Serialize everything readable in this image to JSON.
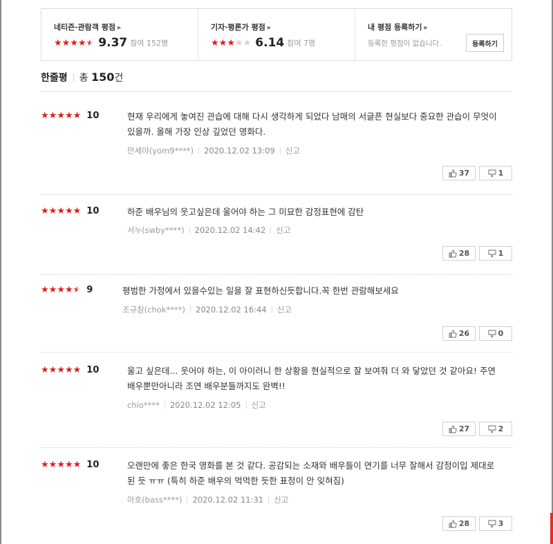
{
  "summary": {
    "netizen": {
      "title": "네티즌·관람객 평점",
      "stars": 4.7,
      "score": "9.37",
      "participants": "참여 152명"
    },
    "critic": {
      "title": "기자·평론가 평점",
      "stars": 3,
      "score": "6.14",
      "participants": "참여 7명"
    },
    "mine": {
      "title": "내 평점 등록하기",
      "empty_text": "등록한 평점이 없습니다.",
      "button_label": "등록하기"
    }
  },
  "reviews_header": {
    "label": "한줄평",
    "prefix": "총 ",
    "count": "150",
    "suffix": "건"
  },
  "reviews": [
    {
      "stars": 5,
      "score": "10",
      "text": "현재 우리에게 놓여진 관습에 대해 다시 생각하게 되었다 남매의 서글픈 현실보다 중요한 관습이 무엇이 있을까. 올해 가장 인상 깊었던 영화다.",
      "author": "만세야(yom9****)",
      "date": "2020.12.02 13:09",
      "report": "신고",
      "likes": "37",
      "dislikes": "1"
    },
    {
      "stars": 5,
      "score": "10",
      "text": "하준 배우님의 웃고싶은데 울어야 하는 그 미묘한 감정표현에 감탄",
      "author": "서누(swby****)",
      "date": "2020.12.02 14:42",
      "report": "신고",
      "likes": "28",
      "dislikes": "1"
    },
    {
      "stars": 4.5,
      "score": "9",
      "text": "평범한 가정에서 있을수있는 일을 잘 표현하신듯합니다.꼭 한번 관람해보세요",
      "author": "조규창(chok****)",
      "date": "2020.12.02 16:44",
      "report": "신고",
      "likes": "26",
      "dislikes": "0"
    },
    {
      "stars": 5,
      "score": "10",
      "text": "울고 싶은데... 웃어야 하는, 이 아이러니 한 상황을 현실적으로 잘 보여줘 더 와 닿았던 것 같아요! 주연 배우뿐만아니라 조연 배우분들까지도 완벽!!",
      "author": "chio****",
      "date": "2020.12.02 12:05",
      "report": "신고",
      "likes": "27",
      "dislikes": "2"
    },
    {
      "stars": 5,
      "score": "10",
      "text": "오랜만에 좋은 한국 영화를 본 것 같다. 공감되는 소재와 배우들이 연기를 너무 잘해서 감정이입 제대로 된 듯 ㅠㅠ (특히 하준 배우의 먹먹한 듯한 표정이 안 잊혀짐)",
      "author": "아호(bass****)",
      "date": "2020.12.02 11:31",
      "report": "신고",
      "likes": "28",
      "dislikes": "3"
    }
  ],
  "colors": {
    "star": "#e01c1c",
    "star_off": "#d4d4d4",
    "accent_mark": "#e62e1f"
  },
  "icons": {
    "like": "thumbs-up-icon",
    "dislike": "thumbs-down-icon",
    "caret": "caret-right-icon"
  }
}
